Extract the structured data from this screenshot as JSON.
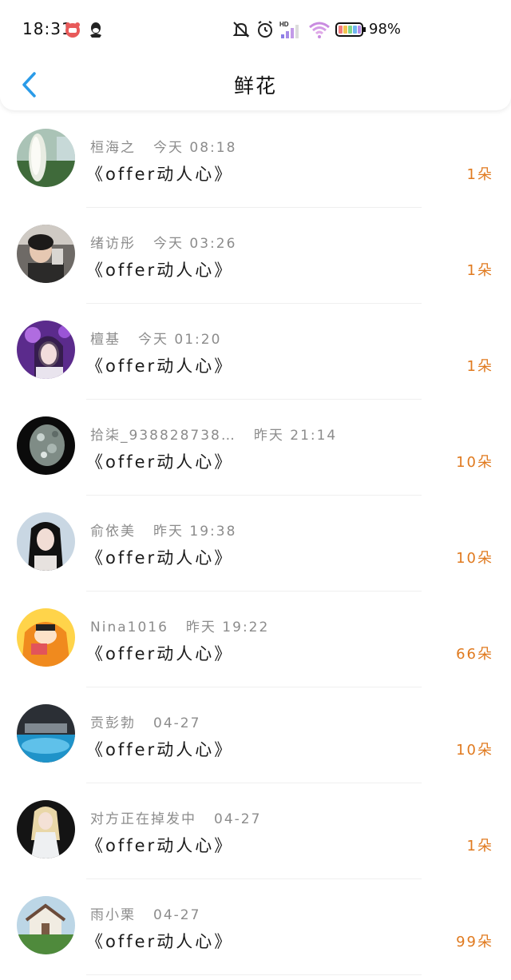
{
  "status_bar": {
    "time": "18:31",
    "battery_percent": "98%"
  },
  "nav": {
    "title": "鲜花"
  },
  "colors": {
    "accent": "#2a9be8",
    "count": "#e07a1f",
    "meta": "#8c8c8c"
  },
  "rows": [
    {
      "name": "桓海之",
      "time": "今天 08:18",
      "gift": "《offer动人心》",
      "count": "1朵"
    },
    {
      "name": "绪访彤",
      "time": "今天 03:26",
      "gift": "《offer动人心》",
      "count": "1朵"
    },
    {
      "name": "檀基",
      "time": "今天 01:20",
      "gift": "《offer动人心》",
      "count": "1朵"
    },
    {
      "name": "拾柒_938828738…",
      "time": "昨天 21:14",
      "gift": "《offer动人心》",
      "count": "10朵"
    },
    {
      "name": "俞依美",
      "time": "昨天 19:38",
      "gift": "《offer动人心》",
      "count": "10朵"
    },
    {
      "name": "Nina1016",
      "time": "昨天 19:22",
      "gift": "《offer动人心》",
      "count": "66朵"
    },
    {
      "name": "贡彭勃",
      "time": "04-27",
      "gift": "《offer动人心》",
      "count": "10朵"
    },
    {
      "name": "对方正在掉发中",
      "time": "04-27",
      "gift": "《offer动人心》",
      "count": "1朵"
    },
    {
      "name": "雨小栗",
      "time": "04-27",
      "gift": "《offer动人心》",
      "count": "99朵"
    }
  ]
}
